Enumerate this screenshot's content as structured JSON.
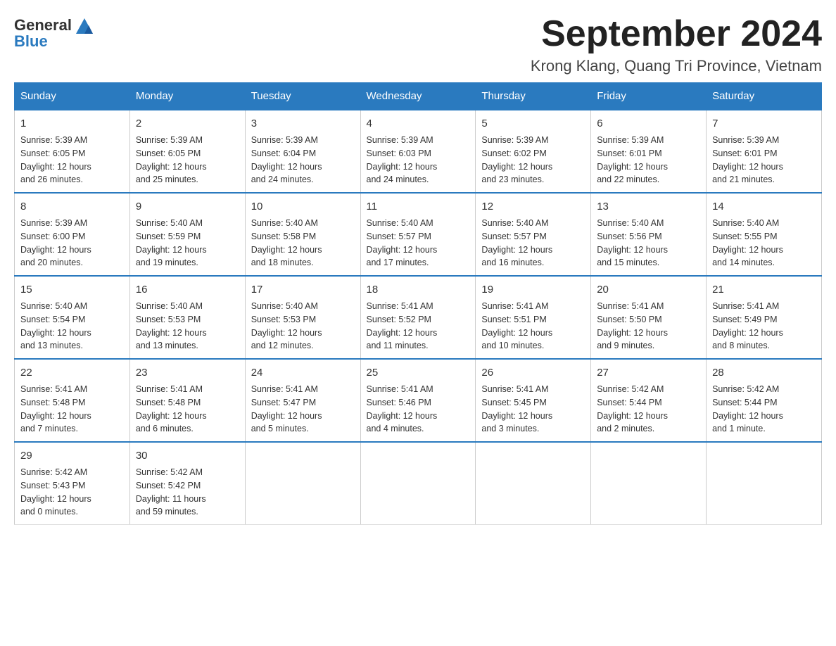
{
  "logo": {
    "text_general": "General",
    "text_blue": "Blue"
  },
  "title": "September 2024",
  "location": "Krong Klang, Quang Tri Province, Vietnam",
  "days_of_week": [
    "Sunday",
    "Monday",
    "Tuesday",
    "Wednesday",
    "Thursday",
    "Friday",
    "Saturday"
  ],
  "weeks": [
    [
      {
        "day": "1",
        "sunrise": "5:39 AM",
        "sunset": "6:05 PM",
        "daylight": "12 hours and 26 minutes."
      },
      {
        "day": "2",
        "sunrise": "5:39 AM",
        "sunset": "6:05 PM",
        "daylight": "12 hours and 25 minutes."
      },
      {
        "day": "3",
        "sunrise": "5:39 AM",
        "sunset": "6:04 PM",
        "daylight": "12 hours and 24 minutes."
      },
      {
        "day": "4",
        "sunrise": "5:39 AM",
        "sunset": "6:03 PM",
        "daylight": "12 hours and 24 minutes."
      },
      {
        "day": "5",
        "sunrise": "5:39 AM",
        "sunset": "6:02 PM",
        "daylight": "12 hours and 23 minutes."
      },
      {
        "day": "6",
        "sunrise": "5:39 AM",
        "sunset": "6:01 PM",
        "daylight": "12 hours and 22 minutes."
      },
      {
        "day": "7",
        "sunrise": "5:39 AM",
        "sunset": "6:01 PM",
        "daylight": "12 hours and 21 minutes."
      }
    ],
    [
      {
        "day": "8",
        "sunrise": "5:39 AM",
        "sunset": "6:00 PM",
        "daylight": "12 hours and 20 minutes."
      },
      {
        "day": "9",
        "sunrise": "5:40 AM",
        "sunset": "5:59 PM",
        "daylight": "12 hours and 19 minutes."
      },
      {
        "day": "10",
        "sunrise": "5:40 AM",
        "sunset": "5:58 PM",
        "daylight": "12 hours and 18 minutes."
      },
      {
        "day": "11",
        "sunrise": "5:40 AM",
        "sunset": "5:57 PM",
        "daylight": "12 hours and 17 minutes."
      },
      {
        "day": "12",
        "sunrise": "5:40 AM",
        "sunset": "5:57 PM",
        "daylight": "12 hours and 16 minutes."
      },
      {
        "day": "13",
        "sunrise": "5:40 AM",
        "sunset": "5:56 PM",
        "daylight": "12 hours and 15 minutes."
      },
      {
        "day": "14",
        "sunrise": "5:40 AM",
        "sunset": "5:55 PM",
        "daylight": "12 hours and 14 minutes."
      }
    ],
    [
      {
        "day": "15",
        "sunrise": "5:40 AM",
        "sunset": "5:54 PM",
        "daylight": "12 hours and 13 minutes."
      },
      {
        "day": "16",
        "sunrise": "5:40 AM",
        "sunset": "5:53 PM",
        "daylight": "12 hours and 13 minutes."
      },
      {
        "day": "17",
        "sunrise": "5:40 AM",
        "sunset": "5:53 PM",
        "daylight": "12 hours and 12 minutes."
      },
      {
        "day": "18",
        "sunrise": "5:41 AM",
        "sunset": "5:52 PM",
        "daylight": "12 hours and 11 minutes."
      },
      {
        "day": "19",
        "sunrise": "5:41 AM",
        "sunset": "5:51 PM",
        "daylight": "12 hours and 10 minutes."
      },
      {
        "day": "20",
        "sunrise": "5:41 AM",
        "sunset": "5:50 PM",
        "daylight": "12 hours and 9 minutes."
      },
      {
        "day": "21",
        "sunrise": "5:41 AM",
        "sunset": "5:49 PM",
        "daylight": "12 hours and 8 minutes."
      }
    ],
    [
      {
        "day": "22",
        "sunrise": "5:41 AM",
        "sunset": "5:48 PM",
        "daylight": "12 hours and 7 minutes."
      },
      {
        "day": "23",
        "sunrise": "5:41 AM",
        "sunset": "5:48 PM",
        "daylight": "12 hours and 6 minutes."
      },
      {
        "day": "24",
        "sunrise": "5:41 AM",
        "sunset": "5:47 PM",
        "daylight": "12 hours and 5 minutes."
      },
      {
        "day": "25",
        "sunrise": "5:41 AM",
        "sunset": "5:46 PM",
        "daylight": "12 hours and 4 minutes."
      },
      {
        "day": "26",
        "sunrise": "5:41 AM",
        "sunset": "5:45 PM",
        "daylight": "12 hours and 3 minutes."
      },
      {
        "day": "27",
        "sunrise": "5:42 AM",
        "sunset": "5:44 PM",
        "daylight": "12 hours and 2 minutes."
      },
      {
        "day": "28",
        "sunrise": "5:42 AM",
        "sunset": "5:44 PM",
        "daylight": "12 hours and 1 minute."
      }
    ],
    [
      {
        "day": "29",
        "sunrise": "5:42 AM",
        "sunset": "5:43 PM",
        "daylight": "12 hours and 0 minutes."
      },
      {
        "day": "30",
        "sunrise": "5:42 AM",
        "sunset": "5:42 PM",
        "daylight": "11 hours and 59 minutes."
      },
      null,
      null,
      null,
      null,
      null
    ]
  ],
  "labels": {
    "sunrise": "Sunrise:",
    "sunset": "Sunset:",
    "daylight": "Daylight:"
  }
}
